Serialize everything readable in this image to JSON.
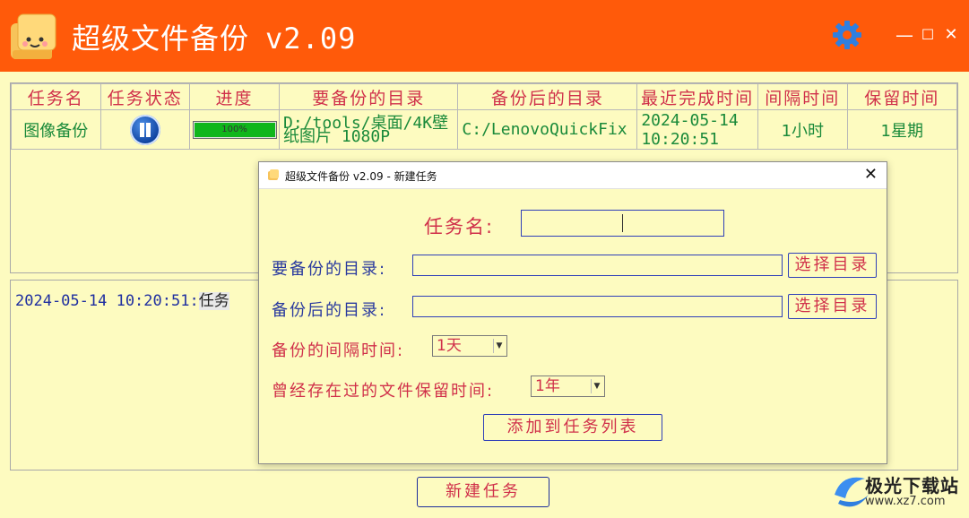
{
  "app": {
    "title": "超级文件备份",
    "version": "v2.09",
    "icons": {
      "settings": "gear-icon",
      "minimize": "minimize-icon",
      "maximize": "maximize-icon",
      "close": "close-icon"
    },
    "window_controls": {
      "minimize": "—",
      "maximize": "☐",
      "close": "✕"
    }
  },
  "table": {
    "headers": [
      "任务名",
      "任务状态",
      "进度",
      "要备份的目录",
      "备份后的目录",
      "最近完成时间",
      "间隔时间",
      "保留时间"
    ],
    "rows": [
      {
        "name": "图像备份",
        "state": "paused",
        "progress_pct": 100,
        "progress_label": "100%",
        "src": "D:/tools/桌面/4K壁纸图片 1080P",
        "dst": "C:/LenovoQuickFix",
        "last_done": "2024-05-14 10:20:51",
        "interval": "1小时",
        "keep": "1星期"
      }
    ]
  },
  "log": {
    "line_time": "2024-05-14 10:20:51:",
    "line_tail": "任务"
  },
  "new_task_button": "新建任务",
  "watermark": {
    "name": "极光下载站",
    "url": "www.xz7.com"
  },
  "dialog": {
    "title": "超级文件备份 v2.09 - 新建任务",
    "task_name_label": "任务名:",
    "task_name_value": "",
    "src_label": "要备份的目录:",
    "src_value": "",
    "dst_label": "备份后的目录:",
    "dst_value": "",
    "pick_dir_label": "选择目录",
    "interval_label": "备份的间隔时间:",
    "interval_value": "1天",
    "keep_label": "曾经存在过的文件保留时间:",
    "keep_value": "1年",
    "add_button": "添加到任务列表"
  },
  "colors": {
    "titlebar": "#ff5a0a",
    "background": "#fdfbc0",
    "header_text": "#d0304a",
    "cell_text": "#1a8a3a",
    "log_text": "#1f2fa0",
    "label_blue": "#2a3a9e",
    "label_red": "#d0304a",
    "progress": "#10b61c"
  }
}
